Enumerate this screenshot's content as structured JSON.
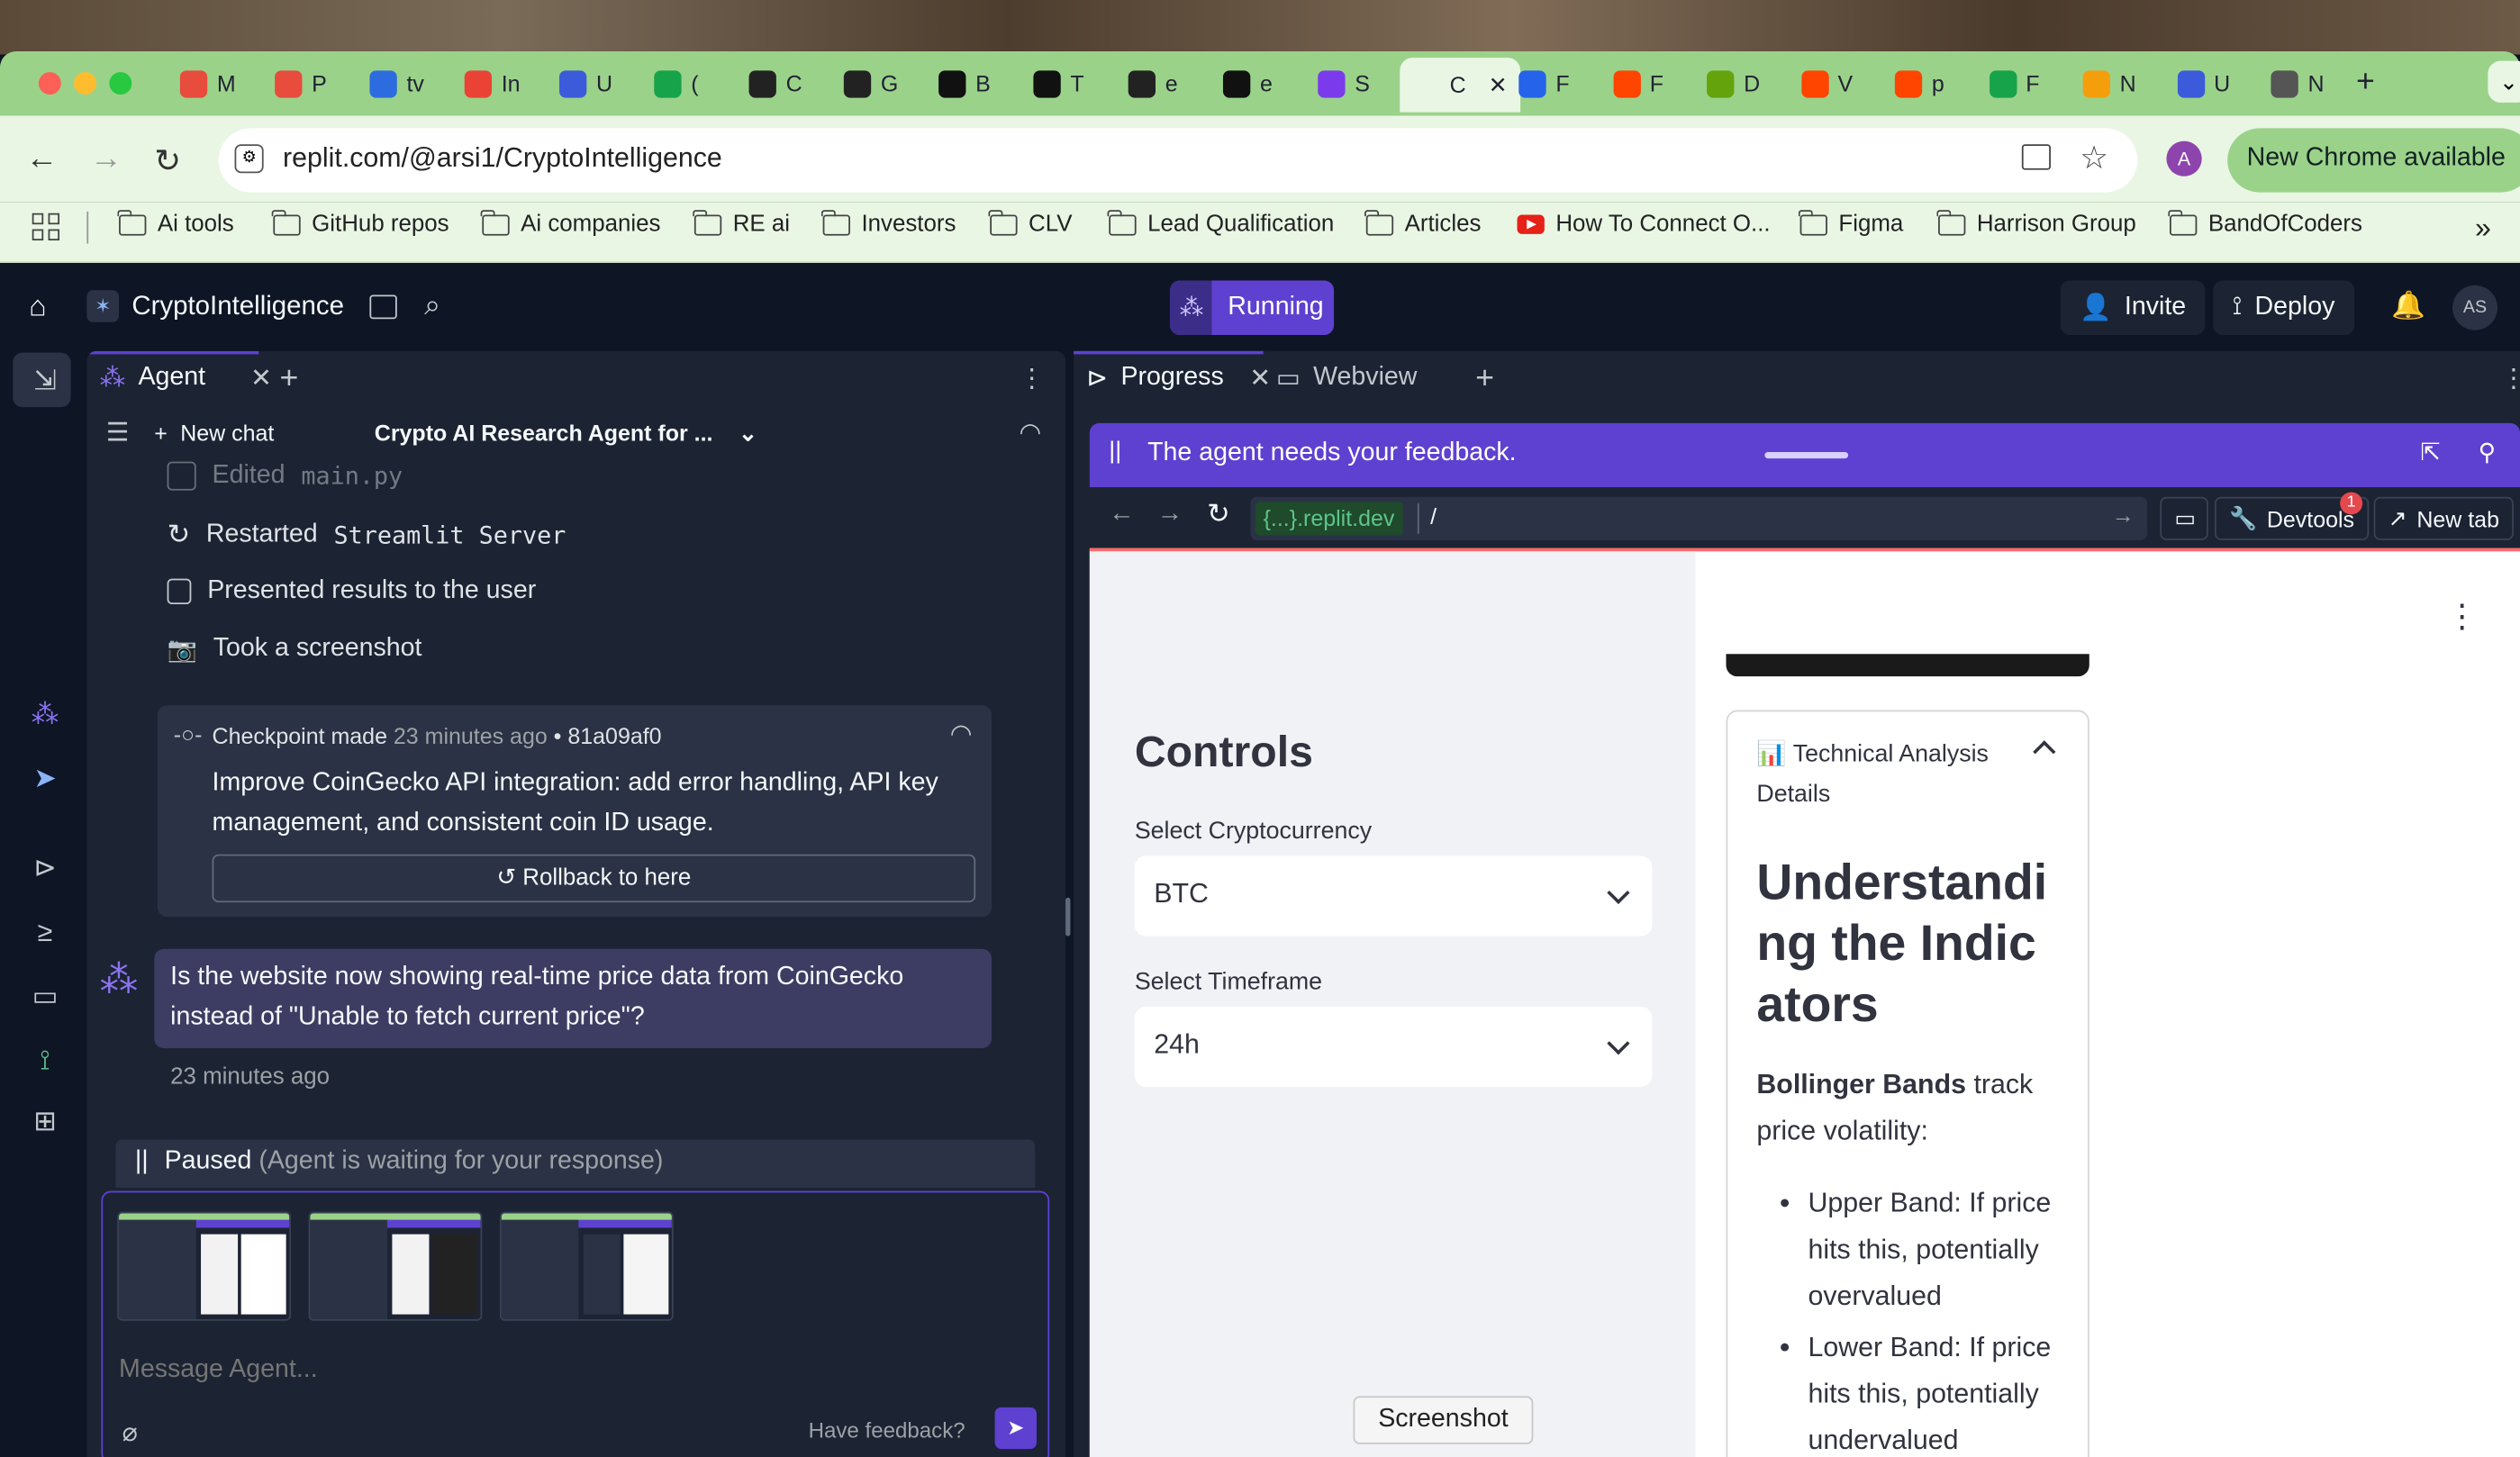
{
  "browser": {
    "tabs": [
      {
        "letter": "M",
        "color": "#e74c3c"
      },
      {
        "letter": "P",
        "color": "#e74c3c"
      },
      {
        "letter": "tv",
        "color": "#2d6cdf"
      },
      {
        "letter": "In",
        "color": "#ea4335"
      },
      {
        "letter": "U",
        "color": "#3b5bdb"
      },
      {
        "letter": "(",
        "color": "#16a34a"
      },
      {
        "letter": "C",
        "color": "#222222"
      },
      {
        "letter": "G",
        "color": "#222222"
      },
      {
        "letter": "B",
        "color": "#111111"
      },
      {
        "letter": "T",
        "color": "#111111"
      },
      {
        "letter": "e",
        "color": "#222222"
      },
      {
        "letter": "e",
        "color": "#111111"
      },
      {
        "letter": "S",
        "color": "#7c3aed"
      },
      {
        "letter": "C",
        "color": "#e9f6e4"
      },
      {
        "letter": "F",
        "color": "#2563eb"
      },
      {
        "letter": "F",
        "color": "#ff4500"
      },
      {
        "letter": "D",
        "color": "#65a30d"
      },
      {
        "letter": "V",
        "color": "#ff4500"
      },
      {
        "letter": "p",
        "color": "#ff4500"
      },
      {
        "letter": "F",
        "color": "#16a34a"
      },
      {
        "letter": "N",
        "color": "#f59e0b"
      },
      {
        "letter": "U",
        "color": "#3b5bdb"
      },
      {
        "letter": "N",
        "color": "#555555"
      }
    ],
    "url": "replit.com/@arsi1/CryptoIntelligence",
    "new_chrome": "New Chrome available",
    "profile_initial": "A",
    "bookmarks": [
      {
        "label": "Ai tools",
        "type": "folder"
      },
      {
        "label": "GitHub repos",
        "type": "folder"
      },
      {
        "label": "Ai companies",
        "type": "folder"
      },
      {
        "label": "RE ai",
        "type": "folder"
      },
      {
        "label": "Investors",
        "type": "folder"
      },
      {
        "label": "CLV",
        "type": "folder"
      },
      {
        "label": "Lead Qualification",
        "type": "folder"
      },
      {
        "label": "Articles",
        "type": "folder"
      },
      {
        "label": "How To Connect O...",
        "type": "youtube"
      },
      {
        "label": "Figma",
        "type": "folder"
      },
      {
        "label": "Harrison Group",
        "type": "folder"
      },
      {
        "label": "BandOfCoders",
        "type": "folder"
      }
    ],
    "more_bookmarks": "»"
  },
  "replit": {
    "project_name": "CryptoIntelligence",
    "run_status": "Running",
    "invite": "Invite",
    "deploy": "Deploy",
    "user_initials": "AS"
  },
  "agent": {
    "tab_label": "Agent",
    "new_chat": "New chat",
    "chat_title": "Crypto AI Research Agent for ...",
    "actions": [
      {
        "verb": "Edited",
        "detail": "main.py"
      },
      {
        "verb": "Restarted",
        "detail": "Streamlit Server"
      },
      {
        "verb": "Presented results to the user",
        "detail": ""
      },
      {
        "verb": "Took a screenshot",
        "detail": ""
      }
    ],
    "checkpoint": {
      "label": "Checkpoint made",
      "time": "23 minutes ago",
      "hash": "• 81a09af0",
      "message": "Improve CoinGecko API integration: add error handling, API key management, and consistent coin ID usage.",
      "rollback": "Rollback to here"
    },
    "user_message": "Is the website now showing real-time price data from CoinGecko instead of \"Unable to fetch current price\"?",
    "user_message_time": "23 minutes ago",
    "paused_label": "Paused",
    "paused_detail": "(Agent is waiting for your response)",
    "input_placeholder": "Message Agent...",
    "have_feedback": "Have feedback?"
  },
  "right_panel": {
    "tabs": [
      {
        "label": "Progress"
      },
      {
        "label": "Webview"
      }
    ],
    "feedback_banner": "The agent needs your feedback.",
    "webview_domain": "{...}.replit.dev",
    "webview_path": "/",
    "devtools": "Devtools",
    "devtools_badge": "1",
    "new_tab": "New tab"
  },
  "streamlit": {
    "controls_title": "Controls",
    "crypto_label": "Select Cryptocurrency",
    "crypto_value": "BTC",
    "timeframe_label": "Select Timeframe",
    "timeframe_value": "24h",
    "expander_icon": "📊",
    "expander_title": "Technical Analysis Details",
    "heading": "Understanding the Indicators",
    "bollinger_bold": "Bollinger Bands",
    "bollinger_rest": " track price volatility:",
    "bullets": [
      "Upper Band: If price hits this, potentially overvalued",
      "Lower Band: If price hits this, potentially undervalued"
    ]
  },
  "tooltip": "Screenshot",
  "colors": {
    "replit_bg": "#0e1525",
    "panel_bg": "#1c2333",
    "accent_purple": "#5e41d0",
    "chrome_green": "#9bd28a"
  }
}
